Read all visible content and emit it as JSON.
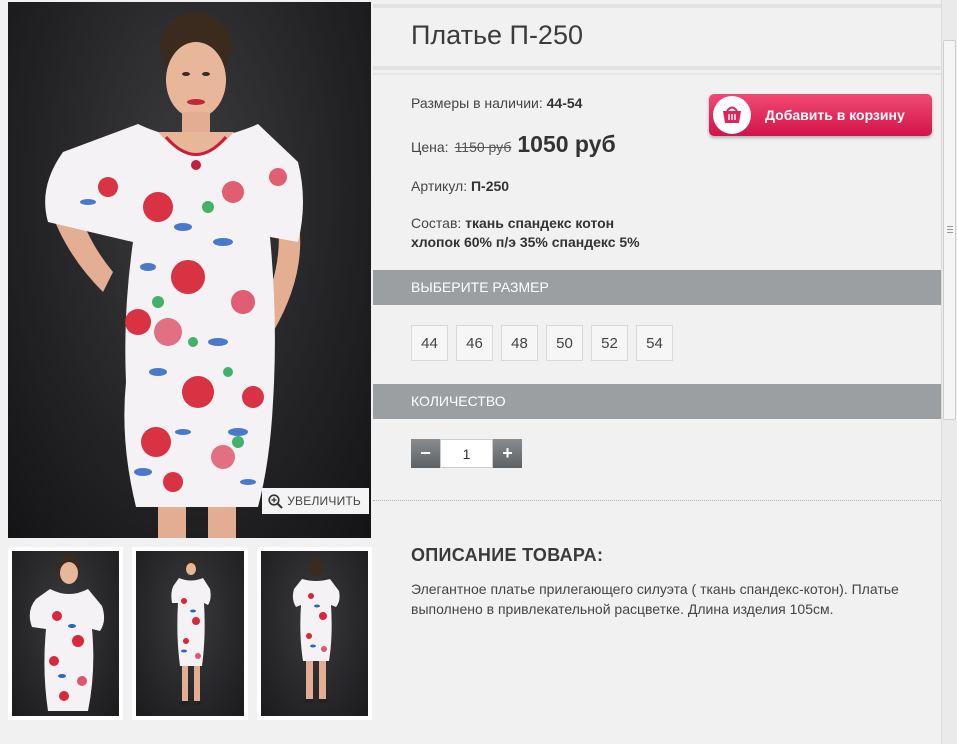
{
  "product": {
    "title": "Платье П-250",
    "sizes_label": "Размеры в наличии:",
    "sizes_value": "44-54",
    "price_label": "Цена:",
    "old_price": "1150 руб",
    "new_price": "1050 руб",
    "article_label": "Артикул:",
    "article_value": "П-250",
    "composition_label": "Состав:",
    "composition_value_1": "ткань спандекс котон",
    "composition_value_2": "хлопок 60% п/э 35% спандекс 5%"
  },
  "cart_button": {
    "label": "Добавить в корзину",
    "color": "#e0245a"
  },
  "zoom_button": {
    "label": "УВЕЛИЧИТЬ"
  },
  "size_section": {
    "header": "ВЫБЕРИТЕ РАЗМЕР",
    "sizes": [
      "44",
      "46",
      "48",
      "50",
      "52",
      "54"
    ]
  },
  "quantity_section": {
    "header": "КОЛИЧЕСТВО",
    "minus": "−",
    "plus": "+",
    "value": "1"
  },
  "description": {
    "title": "ОПИСАНИЕ ТОВАРА:",
    "text": "Элегантное платье прилегающего силуэта ( ткань спандекс-котон). Платье выполнено в привлекательной расцветке. Длина изделия 105см."
  },
  "colors": {
    "bar": "#9b9fa2",
    "background": "#f1f1f1"
  }
}
